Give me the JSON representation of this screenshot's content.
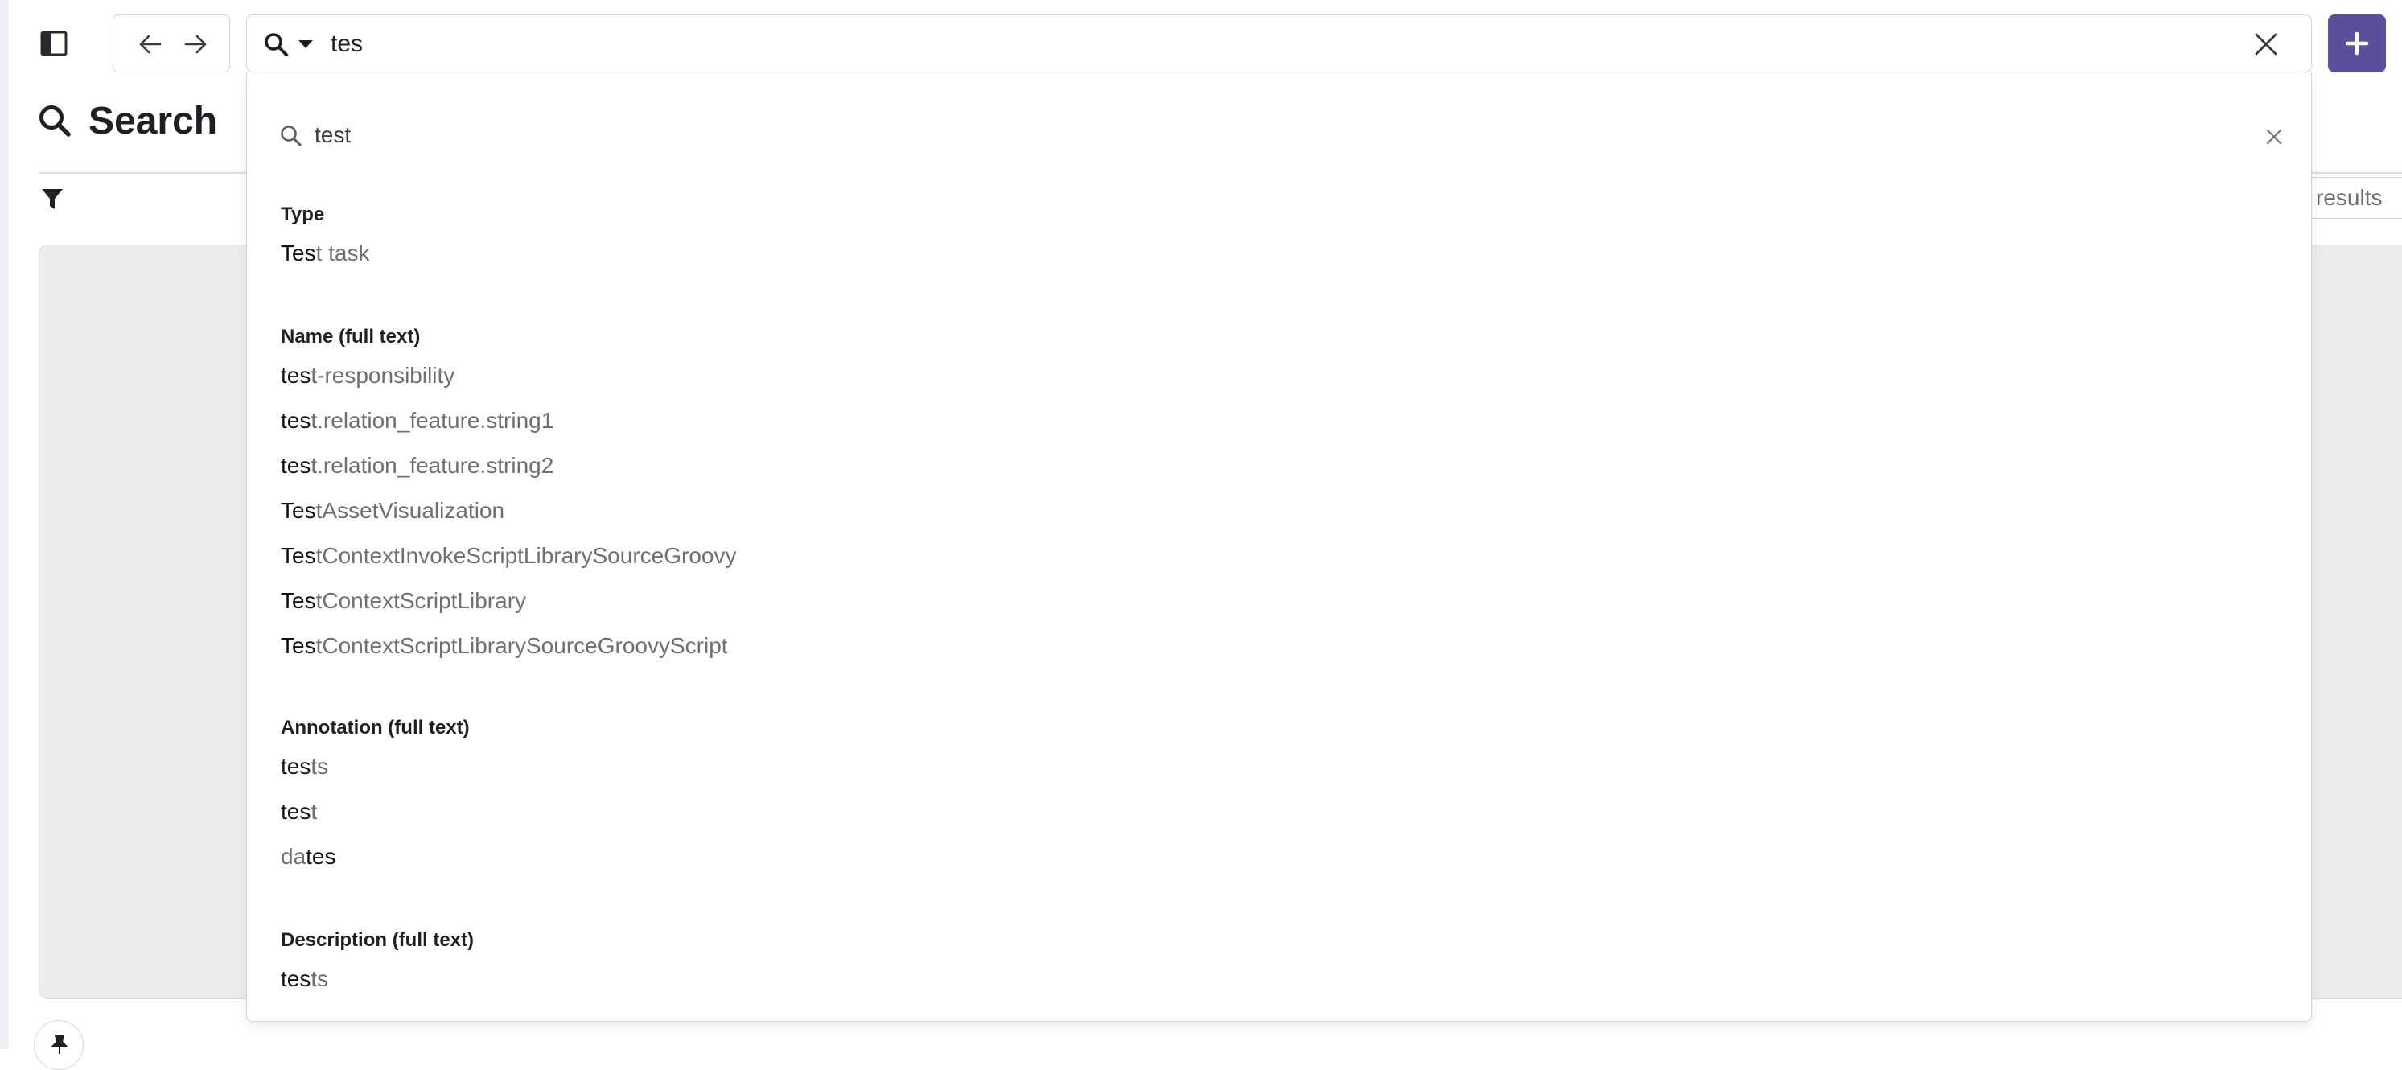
{
  "topbar": {
    "search_query": "tes",
    "icons": {
      "sidebar_toggle": "sidebar-toggle-icon",
      "back": "arrow-left-icon",
      "forward": "arrow-right-icon",
      "search": "search-icon",
      "caret": "caret-down-icon",
      "clear": "close-icon",
      "add": "plus-icon"
    },
    "accent_color": "#5b4e9c"
  },
  "page": {
    "title": "Search",
    "results_label": "results",
    "icons": {
      "title": "search-icon",
      "filter": "filter-icon",
      "pin": "pin-icon"
    }
  },
  "dropdown": {
    "query": "test",
    "sections": [
      {
        "heading": "Type",
        "items": [
          {
            "match": "Tes",
            "rest": "t task"
          }
        ]
      },
      {
        "heading": "Name (full text)",
        "items": [
          {
            "match": "tes",
            "rest": "t-responsibility"
          },
          {
            "match": "tes",
            "rest": "t.relation_feature.string1"
          },
          {
            "match": "tes",
            "rest": "t.relation_feature.string2"
          },
          {
            "match": "Tes",
            "rest": "tAssetVisualization"
          },
          {
            "match": "Tes",
            "rest": "tContextInvokeScriptLibrarySourceGroovy"
          },
          {
            "match": "Tes",
            "rest": "tContextScriptLibrary"
          },
          {
            "match": "Tes",
            "rest": "tContextScriptLibrarySourceGroovyScript"
          }
        ]
      },
      {
        "heading": "Annotation (full text)",
        "items": [
          {
            "match": "tes",
            "rest": "ts"
          },
          {
            "match": "tes",
            "rest": "t"
          },
          {
            "prefix": "da",
            "match": "tes"
          }
        ]
      },
      {
        "heading": "Description (full text)",
        "items": [
          {
            "match": "tes",
            "rest": "ts"
          }
        ]
      }
    ]
  }
}
